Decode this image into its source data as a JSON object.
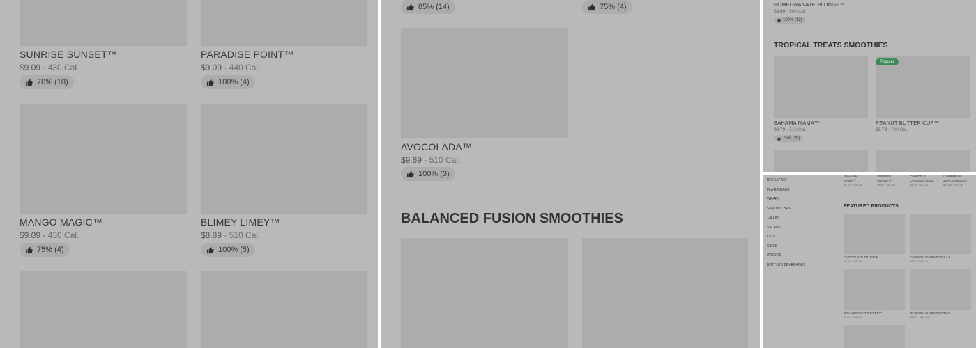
{
  "panel1": {
    "items": [
      {
        "name": "SUNRISE SUNSET™",
        "price": "$9.09",
        "calories": "430 Cal.",
        "rating": "70% (10)"
      },
      {
        "name": "PARADISE POINT™",
        "price": "$9.09",
        "calories": "440 Cal.",
        "rating": "100% (4)"
      },
      {
        "name": "MANGO MAGIC™",
        "price": "$9.09",
        "calories": "430 Cal.",
        "rating": "75% (4)"
      },
      {
        "name": "BLIMEY LIMEY™",
        "price": "$8.89",
        "calories": "510 Cal.",
        "rating": "100% (5)"
      }
    ]
  },
  "panel2": {
    "top_ratings": [
      "85% (14)",
      "75% (4)"
    ],
    "item": {
      "name": "AVOCOLADA™",
      "price": "$9.69",
      "calories": "510 Cal.",
      "rating": "100% (3)"
    },
    "section_title": "BALANCED FUSION SMOOTHIES"
  },
  "panel3": {
    "top_item": {
      "name": "POMEGRANATE PLUNGE™",
      "price": "$9.69",
      "calories": "500 Cal.",
      "rating": "100% (12)"
    },
    "section_title": "TROPICAL TREATS SMOOTHIES",
    "items": [
      {
        "name": "BAHAMA MAMA™",
        "price": "$9.79",
        "calories": "510 Cal.",
        "rating": "75% (28)"
      },
      {
        "name": "PEANUT BUTTER CUP™",
        "price": "$9.79",
        "calories": "700 Cal.",
        "badge": "Popular"
      }
    ]
  },
  "panel4": {
    "nav": [
      "BREAKFAST",
      "FLATBREADS",
      "WRAPS",
      "SANDWICHES",
      "'DILLAS",
      "SALADS",
      "KIDS",
      "SIDES",
      "SWEETS",
      "BOTTLED BEVERAGES"
    ],
    "top_items": [
      {
        "name1": "BAHAMA",
        "name2": "MAMA™",
        "meta": "$9.79 · 510 Cal."
      },
      {
        "name1": "SUNRISE",
        "name2": "SUNSET™",
        "meta": "$9.09 · 430 Cal."
      },
      {
        "name1": "CHIPOTLE",
        "name2": "CHICKEN CLUB",
        "meta": "$9.79 · 520 Cal."
      },
      {
        "name1": "CARIBBEAN",
        "name2": "JERK CHICKEN",
        "meta": "$12.49 · 700 Cal."
      }
    ],
    "featured_title": "FEATURED PRODUCTS",
    "featured": [
      {
        "name": "CHOCOLATE TRUFFLE",
        "meta": "$9.69 · 670 Cal."
      },
      {
        "name": "CHICKEN CHORIZO 'DILLA",
        "meta": "$9.09 · 560 Cal."
      },
      {
        "name": "CRANBERRY TRUFFLE™",
        "meta": "$9.69 · 610 Cal."
      },
      {
        "name": "CHICKEN CHORIZO WRAP",
        "meta": "$12.49 · 860 Cal."
      }
    ]
  },
  "icons": {
    "rating": "thumbs-up-icon"
  },
  "colors": {
    "panel_bg": "#b9b9b9",
    "image_placeholder": "#acacac",
    "badge": "#3f8a5a"
  }
}
